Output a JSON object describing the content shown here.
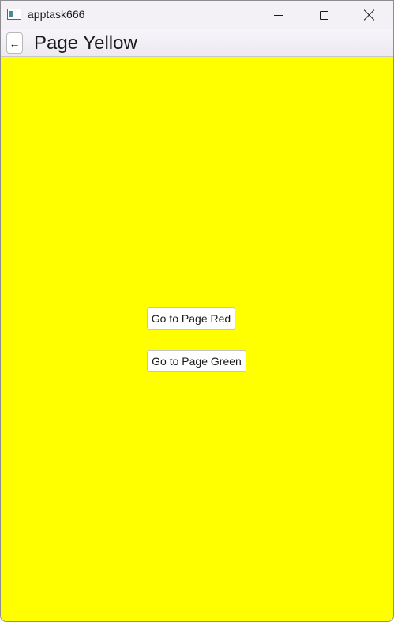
{
  "window": {
    "title": "apptask666",
    "controls": {
      "minimize_icon": "minimize-icon",
      "maximize_icon": "maximize-icon",
      "close_icon": "close-icon"
    }
  },
  "navbar": {
    "back_label": "←",
    "title": "Page Yellow"
  },
  "page": {
    "background_color": "#ffff00",
    "buttons": [
      {
        "label": "Go to Page Red"
      },
      {
        "label": "Go to Page Green"
      }
    ]
  }
}
